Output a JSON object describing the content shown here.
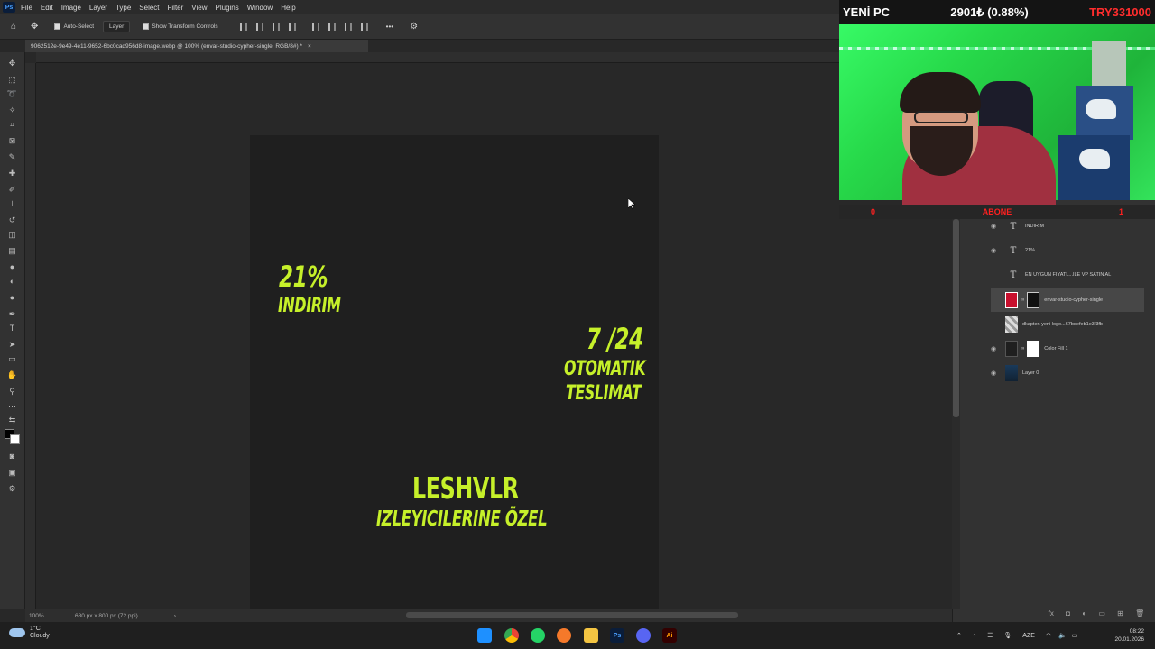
{
  "app": {
    "logo": "Ps",
    "menu": [
      "File",
      "Edit",
      "Image",
      "Layer",
      "Type",
      "Select",
      "Filter",
      "View",
      "Plugins",
      "Window",
      "Help"
    ]
  },
  "options_bar": {
    "auto_select_label": "Auto-Select",
    "auto_select_target": "Layer",
    "show_transform_label": "Show Transform Controls",
    "more_label": "•••"
  },
  "document": {
    "tab_title": "9062512e-9e49-4e11-9652-6bc0cad956d8-image.webp @ 100% (envar-studio-cypher-single, RGB/8#) *",
    "zoom": "100%",
    "size_info": "680 px x 800 px (72 ppi)",
    "status_arrow": "›"
  },
  "artwork": {
    "discount_percent": "21%",
    "discount_word": "INDIRIM",
    "hours": "7 /24",
    "delivery_line1": "OTOMATIK",
    "delivery_line2": "TESLIMAT",
    "streamer": "LESHVLR",
    "audience": "IZLEYICILERINE ÖZEL",
    "text_color": "#c6f02a"
  },
  "layers": [
    {
      "name": "INDIRIM",
      "kind": "text",
      "visible": true
    },
    {
      "name": "21%",
      "kind": "text",
      "visible": true
    },
    {
      "name": "EN UYGUN FIYATL...ILE VP SATIN AL",
      "kind": "text",
      "visible": false
    },
    {
      "name": "envar-studio-cypher-single",
      "kind": "image-mask",
      "visible": false,
      "selected": true
    },
    {
      "name": "dkapten yeni logo...67bdefeb1e3f3fb",
      "kind": "image",
      "visible": false
    },
    {
      "name": "Color Fill 1",
      "kind": "fill",
      "visible": true
    },
    {
      "name": "Layer 0",
      "kind": "image",
      "visible": true
    }
  ],
  "stream_overlay": {
    "ticker_title": "YENİ PC",
    "ticker_change": "2901₺ (0.88%)",
    "ticker_goal": "TRY331000",
    "sub_left": "0",
    "sub_label": "ABONE",
    "sub_right": "1"
  },
  "taskbar": {
    "weather_temp": "1°C",
    "weather_desc": "Cloudy",
    "language": "AZE",
    "time": "08:22",
    "date": "20.01.2026",
    "apps": [
      "windows-start",
      "chrome",
      "whatsapp",
      "blender",
      "file-explorer",
      "photoshop",
      "discord",
      "illustrator"
    ]
  }
}
